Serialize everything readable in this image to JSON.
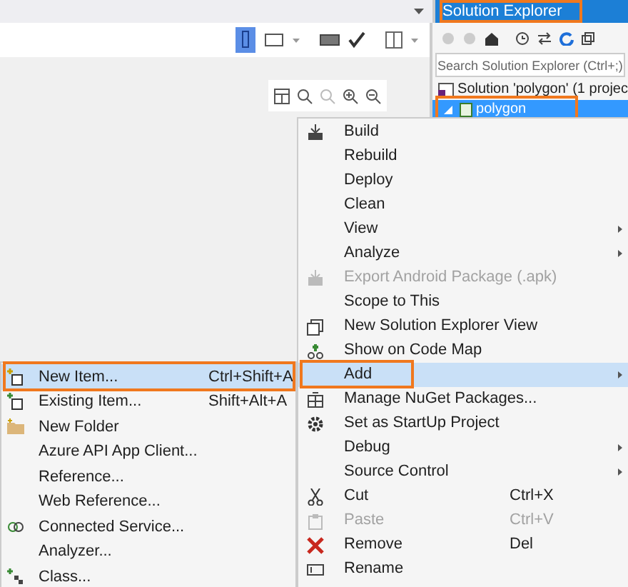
{
  "solution_explorer": {
    "title": "Solution Explorer",
    "title_highlighted": true,
    "search": {
      "placeholder": "Search Solution Explorer (Ctrl+;)"
    },
    "tree": [
      {
        "label": "Solution 'polygon' (1 projec",
        "selected": false,
        "highlighted": false,
        "children": [
          {
            "label": "polygon",
            "selected": true,
            "highlighted": true,
            "expanded": true
          }
        ]
      }
    ]
  },
  "context_menu": [
    {
      "label": "Build",
      "disabled": false,
      "submenu": false,
      "selected": false,
      "highlighted": false
    },
    {
      "label": "Rebuild",
      "disabled": false,
      "submenu": false,
      "selected": false,
      "highlighted": false
    },
    {
      "label": "Deploy",
      "disabled": false,
      "submenu": false,
      "selected": false,
      "highlighted": false
    },
    {
      "label": "Clean",
      "disabled": false,
      "submenu": false,
      "selected": false,
      "highlighted": false
    },
    {
      "label": "View",
      "disabled": false,
      "submenu": true,
      "selected": false,
      "highlighted": false
    },
    {
      "label": "Analyze",
      "disabled": false,
      "submenu": true,
      "selected": false,
      "highlighted": false
    },
    {
      "label": "Export Android Package (.apk)",
      "disabled": true,
      "submenu": false,
      "selected": false,
      "highlighted": false
    },
    {
      "label": "Scope to This",
      "disabled": false,
      "submenu": false,
      "selected": false,
      "highlighted": false
    },
    {
      "label": "New Solution Explorer View",
      "disabled": false,
      "submenu": false,
      "selected": false,
      "highlighted": false
    },
    {
      "label": "Show on Code Map",
      "disabled": false,
      "submenu": false,
      "selected": false,
      "highlighted": false
    },
    {
      "label": "Add",
      "disabled": false,
      "submenu": true,
      "selected": true,
      "highlighted": true
    },
    {
      "label": "Manage NuGet Packages...",
      "disabled": false,
      "submenu": false,
      "selected": false,
      "highlighted": false
    },
    {
      "label": "Set as StartUp Project",
      "disabled": false,
      "submenu": false,
      "selected": false,
      "highlighted": false
    },
    {
      "label": "Debug",
      "disabled": false,
      "submenu": true,
      "selected": false,
      "highlighted": false
    },
    {
      "label": "Source Control",
      "disabled": false,
      "submenu": true,
      "selected": false,
      "highlighted": false
    },
    {
      "label": "Cut",
      "shortcut": "Ctrl+X",
      "disabled": false,
      "submenu": false,
      "selected": false,
      "highlighted": false
    },
    {
      "label": "Paste",
      "shortcut": "Ctrl+V",
      "disabled": true,
      "submenu": false,
      "selected": false,
      "highlighted": false
    },
    {
      "label": "Remove",
      "shortcut": "Del",
      "disabled": false,
      "submenu": false,
      "selected": false,
      "highlighted": false
    },
    {
      "label": "Rename",
      "disabled": false,
      "submenu": false,
      "selected": false,
      "highlighted": false
    }
  ],
  "add_submenu": [
    {
      "label": "New Item...",
      "shortcut": "Ctrl+Shift+A",
      "selected": true,
      "highlighted": true
    },
    {
      "label": "Existing Item...",
      "shortcut": "Shift+Alt+A",
      "selected": false,
      "highlighted": false
    },
    {
      "label": "New Folder",
      "selected": false,
      "highlighted": false
    },
    {
      "label": "Azure API App Client...",
      "selected": false,
      "highlighted": false
    },
    {
      "label": "Reference...",
      "selected": false,
      "highlighted": false
    },
    {
      "label": "Web Reference...",
      "selected": false,
      "highlighted": false
    },
    {
      "label": "Connected Service...",
      "selected": false,
      "highlighted": false
    },
    {
      "label": "Analyzer...",
      "selected": false,
      "highlighted": false
    },
    {
      "label": "Class...",
      "selected": false,
      "highlighted": false
    }
  ]
}
